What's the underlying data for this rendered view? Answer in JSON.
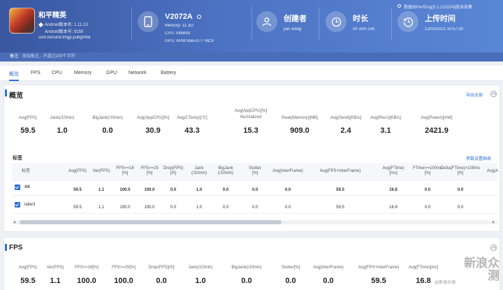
{
  "app": {
    "game_name": "和平精英",
    "android_version": "Android版本名: 1.11.13",
    "android_code": "Android版本号: 9150",
    "package": "com.tencent.tmgp.pubgmhd"
  },
  "device": {
    "model": "V2072A",
    "memory": "Memory: 11.3G",
    "cpu": "CPU: mt6893",
    "gpu": "GPU: ARM Mali-G77 MC9"
  },
  "creator": {
    "title": "创建者",
    "value": "jian wang"
  },
  "duration": {
    "title": "时长",
    "value": "0h 30m 14s"
  },
  "upload": {
    "title": "上传时间",
    "value": "12/03/2021 10:57:30"
  },
  "version_note": "数据由PerfDog(5.1.210204)版本收集",
  "remark": {
    "label": "备注:",
    "value": "添加备注，不超过200个字符"
  },
  "tabs": [
    "概览",
    "FPS",
    "CPU",
    "Memory",
    "GPU",
    "Network",
    "Battery"
  ],
  "overview": {
    "title": "概览",
    "export": "导出全部",
    "stats": [
      {
        "label": "Avg(FPS)",
        "value": "59.5"
      },
      {
        "label": "Jank(/10min)",
        "value": "1.0"
      },
      {
        "label": "BigJank(/10min)",
        "value": "0.0"
      },
      {
        "label": "Avg(AppCPU)[%]",
        "value": "30.9"
      },
      {
        "label": "Avg(CTemp)[°C]",
        "value": "43.3"
      },
      {
        "label": "Avg(AppCPU)[%]",
        "label2": "Normalized",
        "value": "15.3"
      },
      {
        "label": "Peak(Memory)[MB]",
        "value": "909.0"
      },
      {
        "label": "Avg(Send)[KB/s]",
        "value": "2.4"
      },
      {
        "label": "Avg(Recv)[KB/s]",
        "value": "3.1"
      },
      {
        "label": "Avg(Power)[mW]",
        "value": "2421.9"
      }
    ]
  },
  "tags": {
    "title": "标签",
    "param_settings": "参数设置图表",
    "headers": [
      [
        "标签",
        ""
      ],
      [
        "Avg(FPS)",
        ""
      ],
      [
        "Var(FPS)",
        ""
      ],
      [
        "FPS>=18",
        "[%]"
      ],
      [
        "FPS>=25",
        "[%]"
      ],
      [
        "Drop(FPS)",
        "[/h]"
      ],
      [
        "Jank",
        "(/10min)"
      ],
      [
        "BigJank",
        "(/10min)"
      ],
      [
        "Stutter",
        "[%]"
      ],
      [
        "Avg(InterFrame)",
        ""
      ],
      [
        "Avg(FPS+InterFrame)",
        ""
      ],
      [
        "Avg(FTime)",
        "[ms]"
      ],
      [
        "FTime>=100ms",
        "[%]"
      ],
      [
        "Delta(FTime)>100ms",
        "[/h]"
      ],
      [
        "Avg(A",
        ""
      ]
    ],
    "rows": [
      {
        "name": "All",
        "values": [
          "59.5",
          "1.1",
          "100.0",
          "100.0",
          "0.0",
          "1.0",
          "0.0",
          "0.0",
          "0.0",
          "59.5",
          "16.8",
          "0.0",
          "0.0"
        ]
      },
      {
        "name": "label1",
        "values": [
          "59.5",
          "1.1",
          "100.0",
          "100.0",
          "0.0",
          "1.0",
          "0.0",
          "0.0",
          "0.0",
          "59.5",
          "16.8",
          "0.0",
          "0.0"
        ]
      }
    ]
  },
  "fps": {
    "title": "FPS",
    "stats": [
      {
        "label": "Avg(FPS)",
        "value": "59.5"
      },
      {
        "label": "Var(FPS)",
        "value": "1.1"
      },
      {
        "label": "FPS>=18[%]",
        "value": "100.0"
      },
      {
        "label": "FPS>=25[%]",
        "value": "100.0"
      },
      {
        "label": "Drop(FPS)[/h]",
        "value": "0.0"
      },
      {
        "label": "Jank(/10min)",
        "value": "1.0"
      },
      {
        "label": "BigJank(/10min)",
        "value": "0.0"
      },
      {
        "label": "Stutter[%]",
        "value": "0.0"
      },
      {
        "label": "Avg(InterFrame)",
        "value": "0.0"
      },
      {
        "label": "Avg(FPS+InterFrame)",
        "value": "59.5"
      },
      {
        "label": "Avg(FTime)[ms]",
        "value": "16.8"
      }
    ]
  },
  "watermark": {
    "text": "新浪众测",
    "sub": "@新浪众测"
  }
}
